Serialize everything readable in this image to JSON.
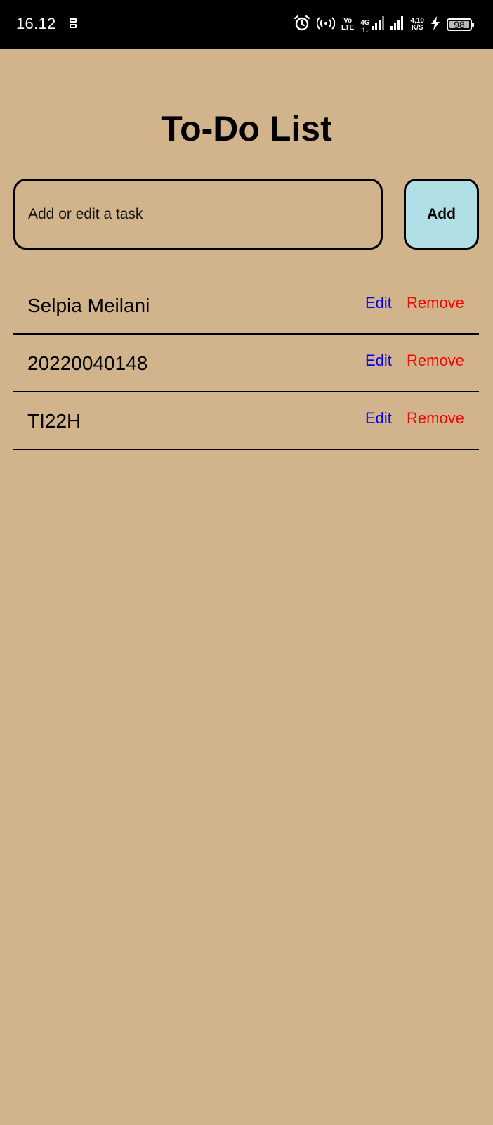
{
  "status_bar": {
    "time": "16.12",
    "volte_top": "Vo",
    "volte_bottom": "LTE",
    "network_type": "4G",
    "network_sub": "↑↓",
    "speed_value": "4,10",
    "speed_unit": "K/S",
    "battery_level": "98",
    "icons": [
      "sync-icon",
      "alarm-icon",
      "hotspot-icon",
      "signal-icon",
      "charging-icon",
      "battery-icon"
    ]
  },
  "app": {
    "title": "To-Do List",
    "input": {
      "placeholder": "Add or edit a task",
      "value": ""
    },
    "add_label": "Add",
    "tasks": [
      {
        "text": "Selpia Meilani",
        "edit_label": "Edit",
        "remove_label": "Remove"
      },
      {
        "text": "20220040148",
        "edit_label": "Edit",
        "remove_label": "Remove"
      },
      {
        "text": "TI22H",
        "edit_label": "Edit",
        "remove_label": "Remove"
      }
    ]
  },
  "colors": {
    "background": "#d2b48c",
    "add_button": "#b0e0e6",
    "edit_link": "#0000ee",
    "remove_link": "#ff0000"
  }
}
